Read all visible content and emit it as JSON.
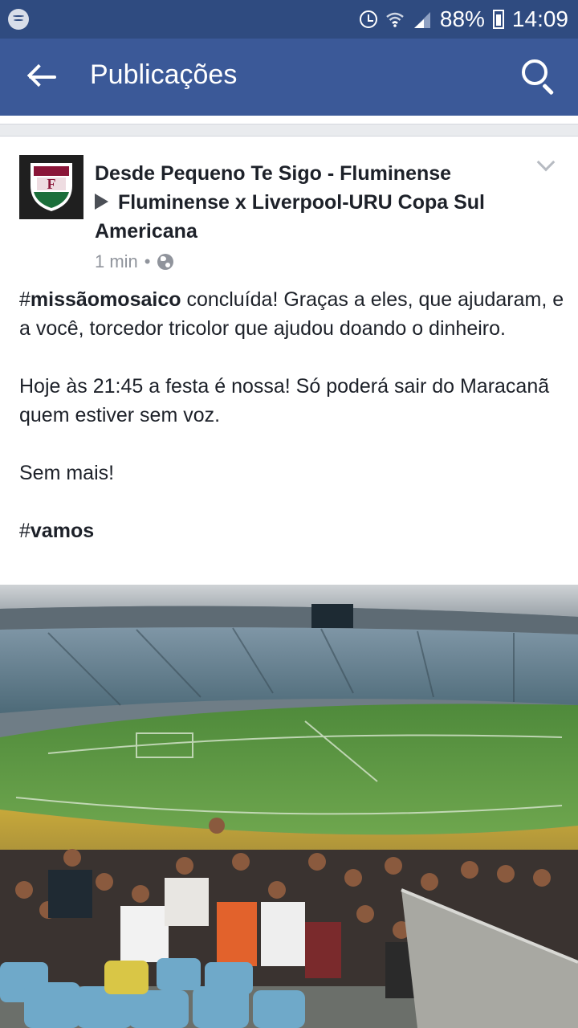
{
  "status_bar": {
    "battery_percent": "88%",
    "time": "14:09",
    "icons": [
      "spotify-icon",
      "alarm-icon",
      "wifi-icon",
      "signal-icon",
      "battery-icon"
    ]
  },
  "app_bar": {
    "title": "Publicações",
    "color": "#3b5998"
  },
  "post": {
    "page_name": "Desde Pequeno Te Sigo - Fluminense",
    "event_title": "Fluminense x Liverpool-URU Copa Sul Americana",
    "time_ago": "1 min",
    "separator": "•",
    "body": {
      "p1_hashtag": "missãomosaico",
      "p1_text": " concluída! Graças a eles, que ajudaram, e a você, torcedor tricolor que ajudou doando o dinheiro.",
      "p2_text": "Hoje às 21:45 a festa é nossa! Só poderá sair do Maracanã quem estiver sem voz.",
      "p3_text": "Sem mais!",
      "p4_hashtag": "vamos"
    }
  }
}
